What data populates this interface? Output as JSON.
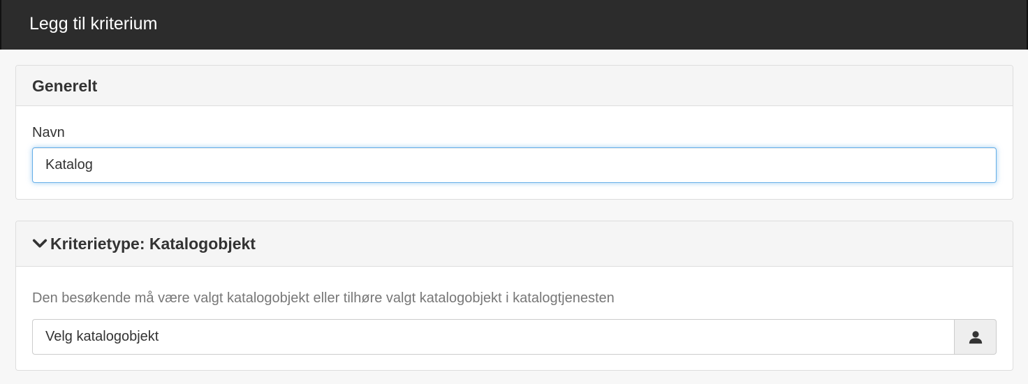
{
  "header": {
    "title": "Legg til kriterium"
  },
  "general": {
    "heading": "Generelt",
    "name_label": "Navn",
    "name_value": "Katalog"
  },
  "criteria": {
    "heading": "Kriterietype: Katalogobjekt",
    "heading_icon": "chevron-down-icon",
    "description": "Den besøkende må være valgt katalogobjekt eller tilhøre valgt katalogobjekt i katalogtjenesten",
    "catalog_placeholder": "Velg katalogobjekt",
    "picker_icon": "user-icon"
  },
  "colors": {
    "topbar": "#2c2c2c",
    "focus_border": "#66afe9",
    "panel_heading_bg": "#f5f5f5"
  }
}
